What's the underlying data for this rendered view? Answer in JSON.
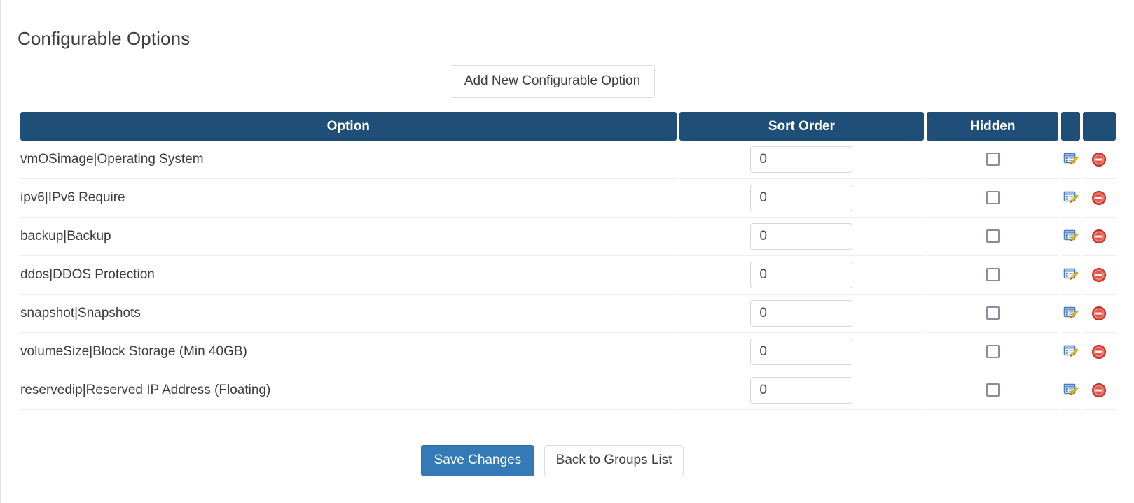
{
  "page": {
    "title": "Configurable Options"
  },
  "toolbar": {
    "add_option_label": "Add New Configurable Option"
  },
  "table": {
    "columns": [
      {
        "key": "option",
        "label": "Option"
      },
      {
        "key": "sort_order",
        "label": "Sort Order"
      },
      {
        "key": "hidden",
        "label": "Hidden"
      },
      {
        "key": "edit",
        "label": ""
      },
      {
        "key": "delete",
        "label": ""
      }
    ],
    "rows": [
      {
        "option": "vmOSimage|Operating System",
        "sort_order": "0",
        "hidden": false,
        "edit_icon": "edit-icon",
        "delete_icon": "delete-icon"
      },
      {
        "option": "ipv6|IPv6 Require",
        "sort_order": "0",
        "hidden": false,
        "edit_icon": "edit-icon",
        "delete_icon": "delete-icon"
      },
      {
        "option": "backup|Backup",
        "sort_order": "0",
        "hidden": false,
        "edit_icon": "edit-icon",
        "delete_icon": "delete-icon"
      },
      {
        "option": "ddos|DDOS Protection",
        "sort_order": "0",
        "hidden": false,
        "edit_icon": "edit-icon",
        "delete_icon": "delete-icon"
      },
      {
        "option": "snapshot|Snapshots",
        "sort_order": "0",
        "hidden": false,
        "edit_icon": "edit-icon",
        "delete_icon": "delete-icon"
      },
      {
        "option": "volumeSize|Block Storage (Min 40GB)",
        "sort_order": "0",
        "hidden": false,
        "edit_icon": "edit-icon",
        "delete_icon": "delete-icon"
      },
      {
        "option": "reservedip|Reserved IP Address (Floating)",
        "sort_order": "0",
        "hidden": false,
        "edit_icon": "edit-icon",
        "delete_icon": "delete-icon"
      }
    ]
  },
  "footer": {
    "save_label": "Save Changes",
    "back_label": "Back to Groups List"
  },
  "colors": {
    "table_header_bg": "#1f4e79",
    "save_button_bg": "#337ab7",
    "delete_icon": "#d9342b",
    "edit_icon_frame": "#4a7ebb",
    "edit_icon_pencil": "#f0c419",
    "text": "#3c3c3c",
    "row_divider": "#eeeeee"
  }
}
